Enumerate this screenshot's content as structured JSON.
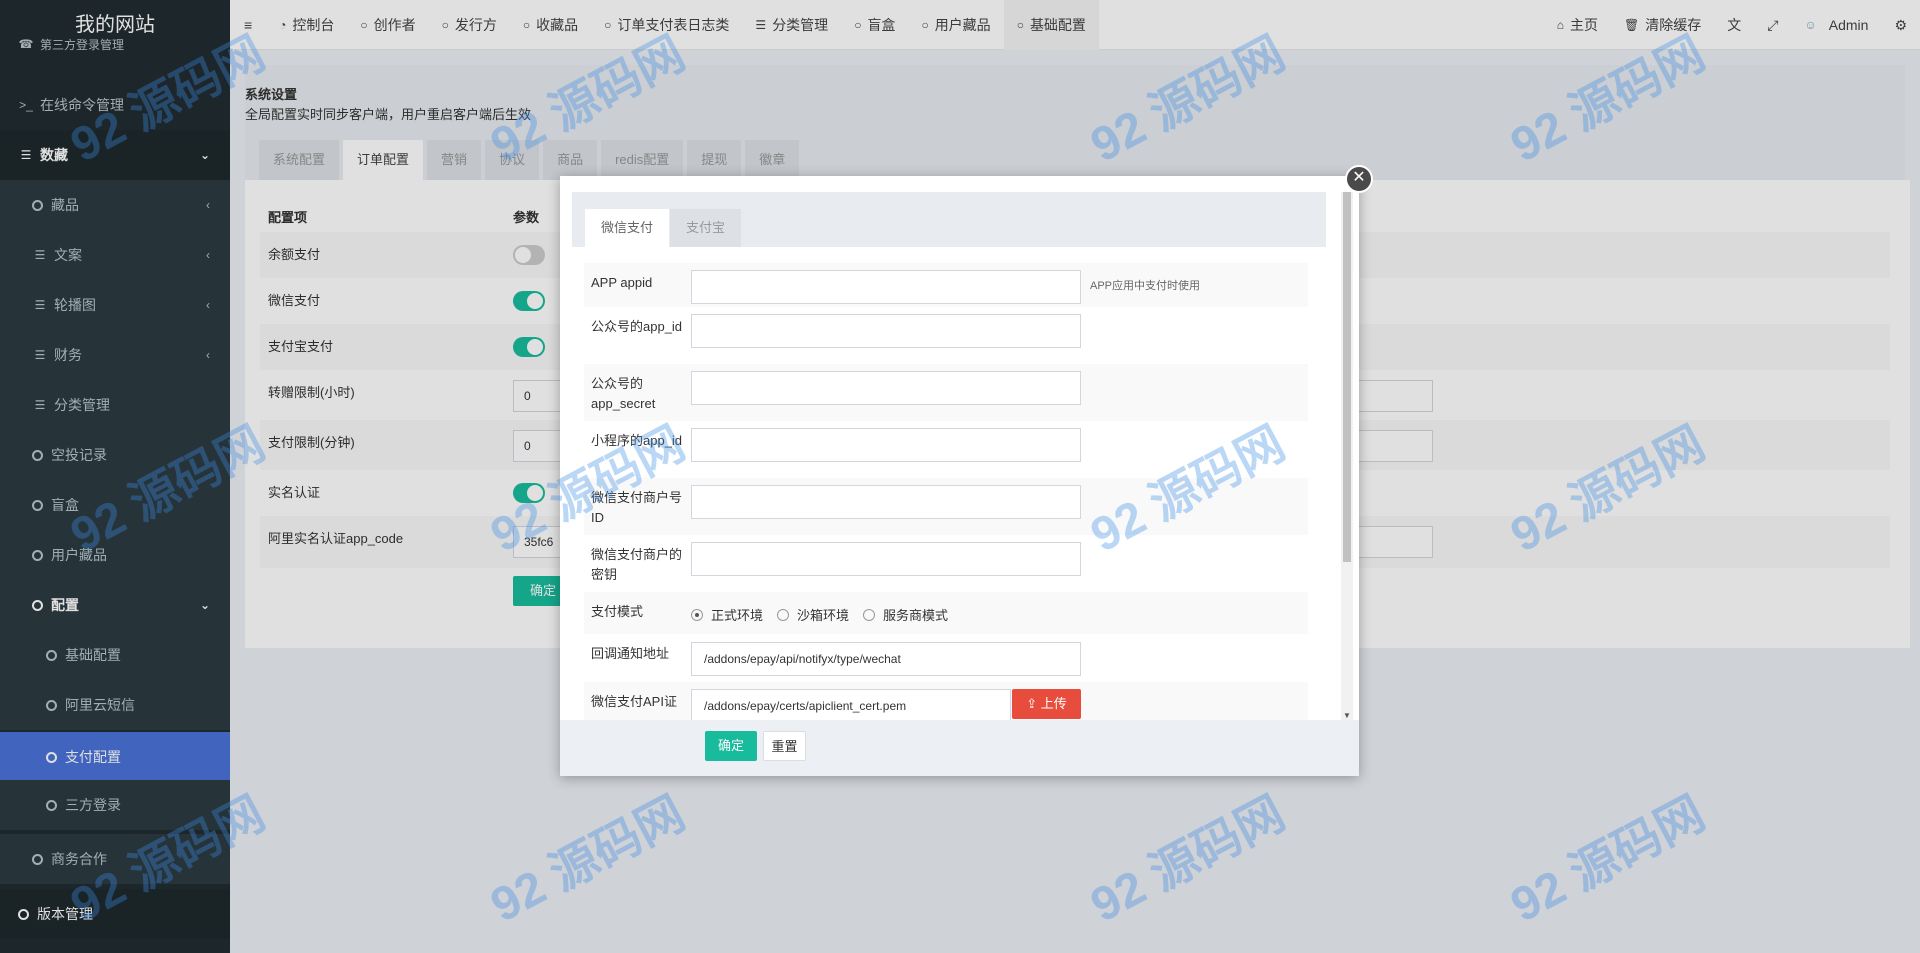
{
  "sidebar": {
    "logo": "我的网站",
    "items": [
      {
        "label": "第三方登录管理"
      },
      {
        "label": "在线命令管理"
      },
      {
        "label": "数藏"
      },
      {
        "label": "藏品"
      },
      {
        "label": "文案"
      },
      {
        "label": "轮播图"
      },
      {
        "label": "财务"
      },
      {
        "label": "分类管理"
      },
      {
        "label": "空投记录"
      },
      {
        "label": "盲盒"
      },
      {
        "label": "用户藏品"
      },
      {
        "label": "配置"
      },
      {
        "label": "基础配置"
      },
      {
        "label": "阿里云短信"
      },
      {
        "label": "支付配置"
      },
      {
        "label": "三方登录"
      },
      {
        "label": "商务合作"
      },
      {
        "label": "版本管理"
      }
    ]
  },
  "topbar": {
    "tabs": [
      {
        "label": "控制台"
      },
      {
        "label": "创作者"
      },
      {
        "label": "发行方"
      },
      {
        "label": "收藏品"
      },
      {
        "label": "订单支付表日志类"
      },
      {
        "label": "分类管理"
      },
      {
        "label": "盲盒"
      },
      {
        "label": "用户藏品"
      },
      {
        "label": "基础配置"
      }
    ],
    "home": "主页",
    "clear_cache": "清除缓存",
    "user": "Admin"
  },
  "page": {
    "title": "系统设置",
    "subtitle": "全局配置实时同步客户端，用户重启客户端后生效",
    "tabs": [
      {
        "label": "系统配置"
      },
      {
        "label": "订单配置"
      },
      {
        "label": "营销"
      },
      {
        "label": "协议"
      },
      {
        "label": "商品"
      },
      {
        "label": "redis配置"
      },
      {
        "label": "提现"
      },
      {
        "label": "徽章"
      }
    ],
    "col_item": "配置项",
    "col_param": "参数",
    "rows": [
      {
        "label": "余额支付"
      },
      {
        "label": "微信支付"
      },
      {
        "label": "支付宝支付"
      },
      {
        "label": "转赠限制(小时)",
        "value": "0"
      },
      {
        "label": "支付限制(分钟)",
        "value": "0"
      },
      {
        "label": "实名认证"
      },
      {
        "label": "阿里实名认证app_code",
        "value": "35fc6"
      }
    ],
    "confirm": "确定"
  },
  "modal": {
    "tabs": [
      {
        "label": "微信支付"
      },
      {
        "label": "支付宝"
      }
    ],
    "fields": [
      {
        "label": "APP appid",
        "value": "",
        "help": "APP应用中支付时使用"
      },
      {
        "label": "公众号的app_id",
        "value": ""
      },
      {
        "label": "公众号的app_secret",
        "value": ""
      },
      {
        "label": "小程序的app_id",
        "value": ""
      },
      {
        "label": "微信支付商户号ID",
        "value": ""
      },
      {
        "label": "微信支付商户的密钥",
        "value": ""
      },
      {
        "label": "支付模式"
      },
      {
        "label": "回调通知地址",
        "value": "/addons/epay/api/notifyx/type/wechat"
      },
      {
        "label": "微信支付API证",
        "value": "/addons/epay/certs/apiclient_cert.pem"
      }
    ],
    "modes": [
      {
        "label": "正式环境",
        "checked": true
      },
      {
        "label": "沙箱环境",
        "checked": false
      },
      {
        "label": "服务商模式",
        "checked": false
      }
    ],
    "upload": "上传",
    "confirm": "确定",
    "reset": "重置"
  },
  "colors": {
    "accent": "#18bc9c",
    "active_side": "#4a74d9",
    "upload": "#e74c3c"
  }
}
